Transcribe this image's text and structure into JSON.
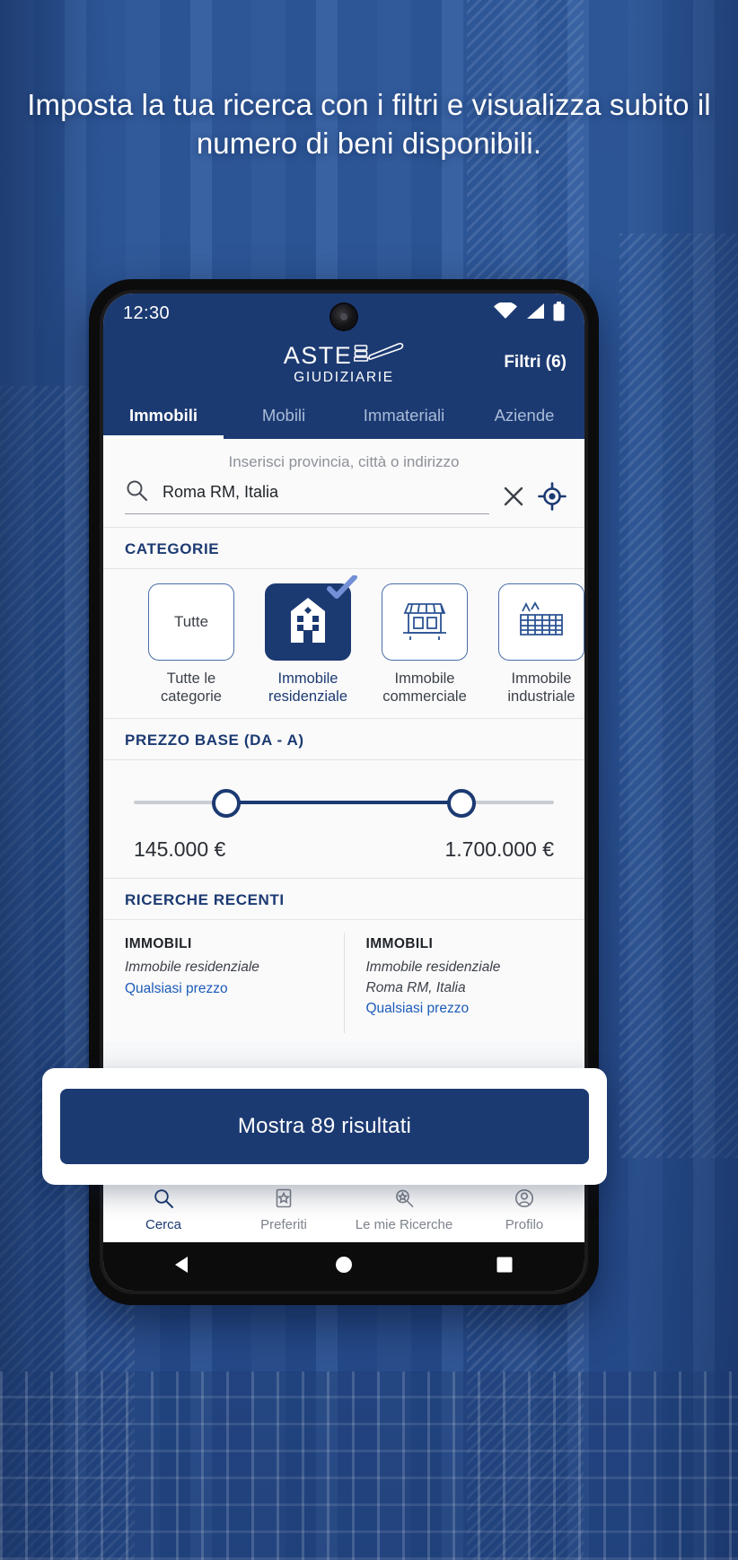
{
  "headline": "Imposta la tua ricerca con i filtri e visualizza subito il numero di beni disponibili.",
  "colors": {
    "brand_blue": "#1c3a72",
    "accent_link": "#1c5bb8",
    "screen_bg": "#f7f8f9"
  },
  "phone": {
    "status": {
      "time": "12:30",
      "wifi_icon": "wifi-icon",
      "signal_icon": "signal-icon",
      "battery_icon": "battery-icon"
    },
    "appbar": {
      "logo_main": "ASTE",
      "logo_sub": "GIUDIZIARIE",
      "logo_icon": "gavel-icon",
      "filters_label": "Filtri (6)"
    },
    "tabs": [
      {
        "label": "Immobili",
        "active": true
      },
      {
        "label": "Mobili",
        "active": false
      },
      {
        "label": "Immateriali",
        "active": false
      },
      {
        "label": "Aziende",
        "active": false
      }
    ],
    "search": {
      "hint": "Inserisci provincia, città o indirizzo",
      "value": "Roma RM, Italia",
      "placeholder": "Inserisci provincia, città o indirizzo",
      "search_icon": "search-icon",
      "clear_icon": "close-icon",
      "locate_icon": "crosshair-location-icon"
    },
    "categories": {
      "title": "CATEGORIE",
      "items": [
        {
          "tile_text": "Tutte",
          "icon": "",
          "label": "Tutte le categorie",
          "selected": false
        },
        {
          "tile_text": "",
          "icon": "residential-building-icon",
          "label": "Immobile residenziale",
          "selected": true
        },
        {
          "tile_text": "",
          "icon": "shop-storefront-icon",
          "label": "Immobile commerciale",
          "selected": false
        },
        {
          "tile_text": "",
          "icon": "factory-icon",
          "label": "Immobile industriale",
          "selected": false
        }
      ]
    },
    "price": {
      "title": "PREZZO BASE (DA - A)",
      "min_label": "145.000 €",
      "max_label": "1.700.000 €"
    },
    "recent": {
      "title": "RICERCHE RECENTI",
      "cards": [
        {
          "heading": "IMMOBILI",
          "lines": [
            "Immobile residenziale"
          ],
          "link": "Qualsiasi prezzo"
        },
        {
          "heading": "IMMOBILI",
          "lines": [
            "Immobile residenziale",
            "Roma RM, Italia"
          ],
          "link": "Qualsiasi prezzo"
        }
      ]
    },
    "cta": {
      "label": "Mostra 89 risultati"
    },
    "bottom_nav": [
      {
        "label": "Cerca",
        "icon": "search-icon",
        "active": true
      },
      {
        "label": "Preferiti",
        "icon": "star-bookmark-icon",
        "active": false
      },
      {
        "label": "Le mie Ricerche",
        "icon": "saved-search-icon",
        "active": false
      },
      {
        "label": "Profilo",
        "icon": "person-icon",
        "active": false
      }
    ],
    "android_nav": {
      "back": "back-triangle-icon",
      "home": "home-circle-icon",
      "recents": "recents-square-icon"
    }
  }
}
